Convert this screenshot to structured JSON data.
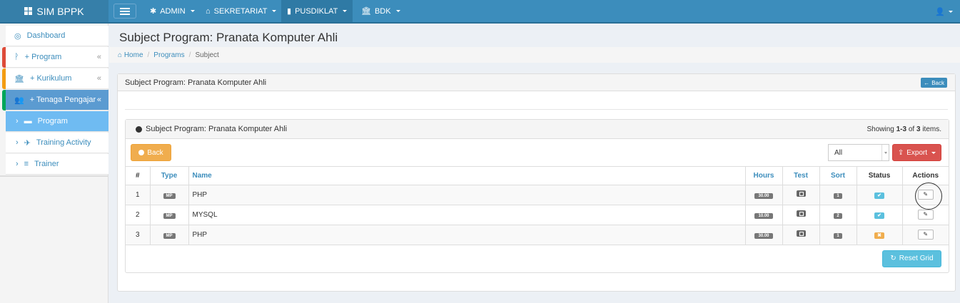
{
  "app": {
    "brand": "SIM BPPK"
  },
  "topnav": {
    "items": [
      {
        "label": "ADMIN",
        "icon": "gear-icon"
      },
      {
        "label": "SEKRETARIAT",
        "icon": "home-icon"
      },
      {
        "label": "PUSDIKLAT",
        "icon": "building-icon",
        "active": true
      },
      {
        "label": "BDK",
        "icon": "bank-icon"
      }
    ]
  },
  "sidebar": {
    "items": [
      {
        "label": "Dashboard",
        "icon": "dashboard-icon"
      },
      {
        "label": "+ Program",
        "icon": "program-icon",
        "marker": "#dd4b39"
      },
      {
        "label": "+ Kurikulum",
        "icon": "bank-icon",
        "marker": "#f39c12"
      },
      {
        "label": "+ Tenaga Pengajar",
        "icon": "users-icon",
        "marker": "#00a65a"
      },
      {
        "label": "Program",
        "icon": "list-icon"
      },
      {
        "label": "Training Activity",
        "icon": "rocket-icon"
      },
      {
        "label": "Trainer",
        "icon": "list-icon"
      }
    ]
  },
  "page": {
    "title": "Subject Program: Pranata Komputer Ahli",
    "breadcrumb": {
      "home": "Home",
      "programs": "Programs",
      "current": "Subject"
    }
  },
  "panel": {
    "title": "Subject Program: Pranata Komputer Ahli",
    "back_small": "Back"
  },
  "grid": {
    "title": "Subject Program: Pranata Komputer Ahli",
    "summary_prefix": "Showing",
    "summary_range": "1-3",
    "summary_of": "of",
    "summary_total": "3",
    "summary_suffix": "items.",
    "back_label": "Back",
    "filter_value": "All",
    "export_label": "Export",
    "reset_label": "Reset Grid",
    "columns": {
      "num": "#",
      "type": "Type",
      "name": "Name",
      "hours": "Hours",
      "test": "Test",
      "sort": "Sort",
      "status": "Status",
      "actions": "Actions"
    },
    "rows": [
      {
        "num": "1",
        "type": "MP",
        "name": "PHP",
        "hours": "30.00",
        "sort": "1",
        "status": "active"
      },
      {
        "num": "2",
        "type": "MP",
        "name": "MYSQL",
        "hours": "10.00",
        "sort": "2",
        "status": "active"
      },
      {
        "num": "3",
        "type": "MP",
        "name": "PHP",
        "hours": "30.00",
        "sort": "1",
        "status": "inactive"
      }
    ]
  },
  "colors": {
    "navbar": "#3c8dbc",
    "warning": "#f0ad4e",
    "danger": "#d9534f",
    "info": "#5bc0de"
  }
}
